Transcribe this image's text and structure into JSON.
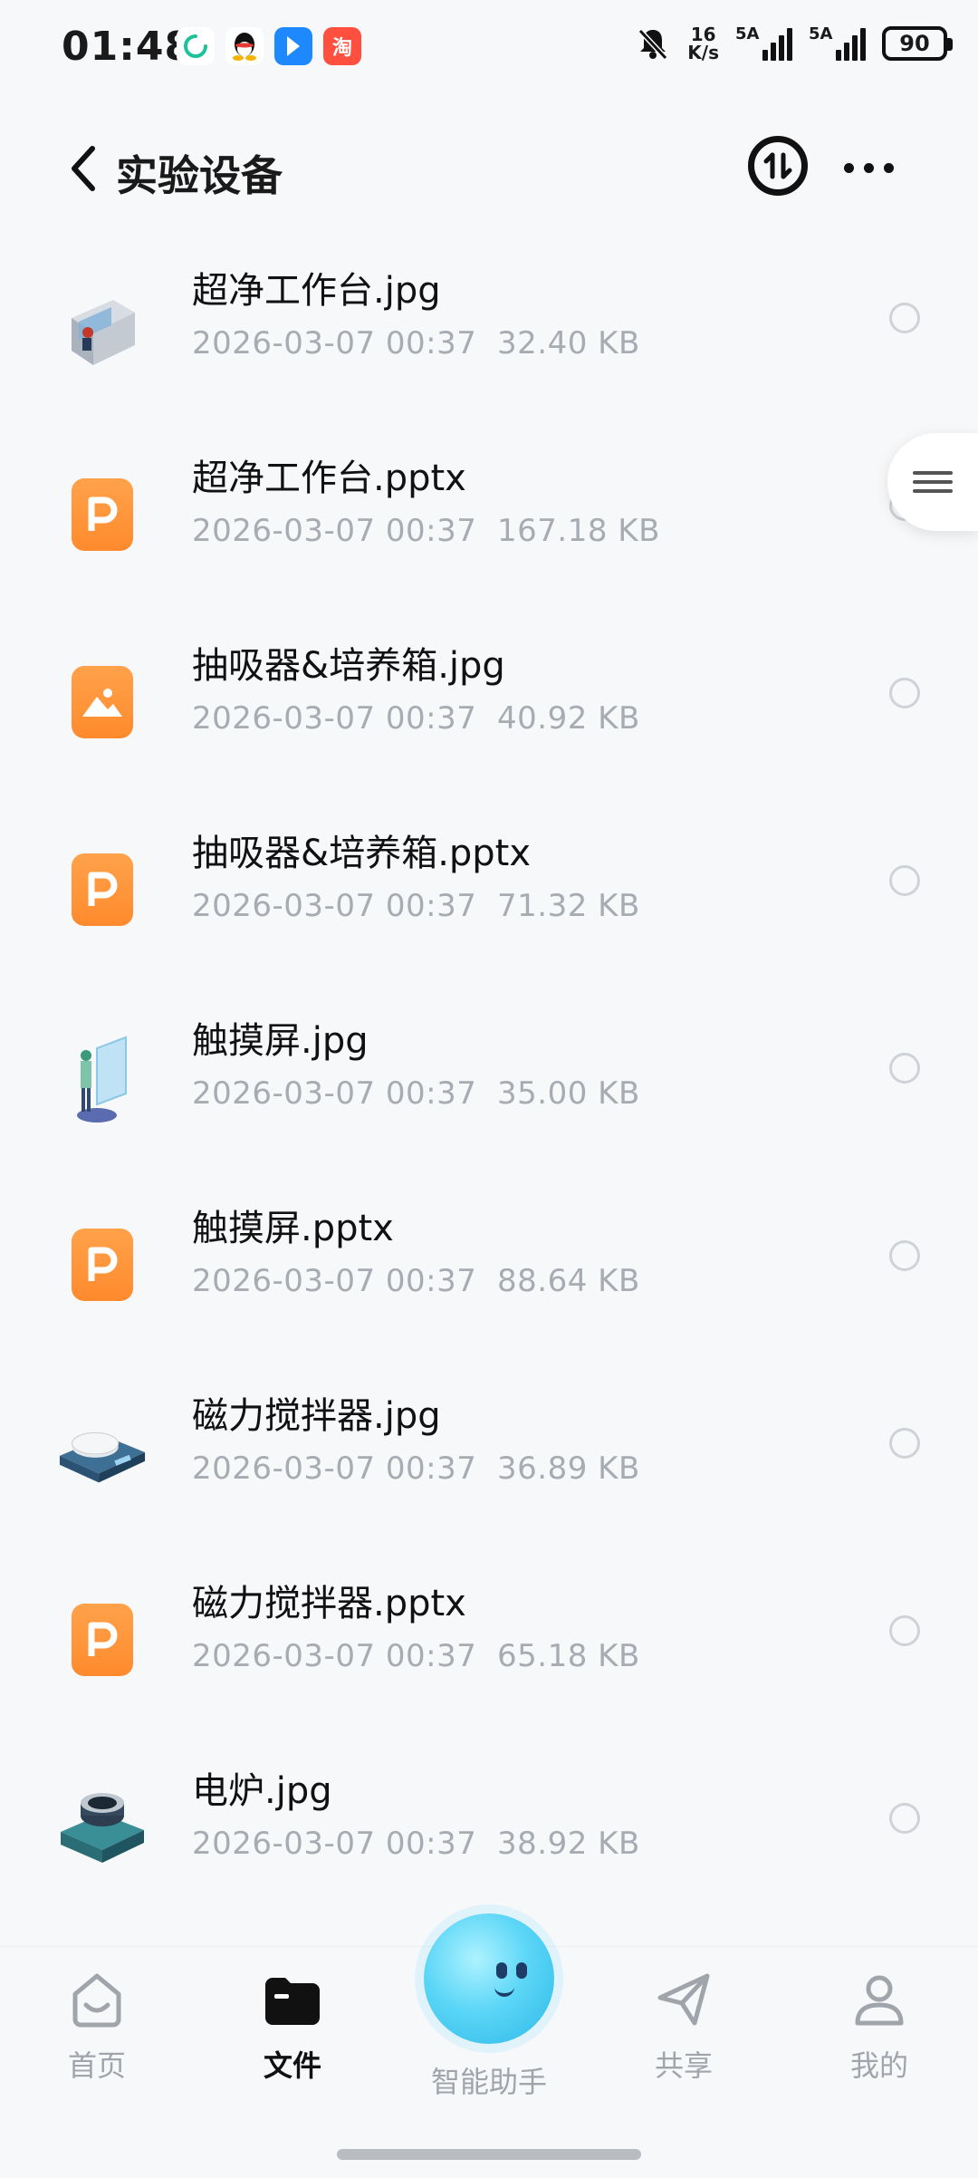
{
  "status_bar": {
    "time": "01:48",
    "net_speed_value": "16",
    "net_speed_unit": "K/s",
    "sim1_label": "5A",
    "sim2_label": "5A",
    "battery": "90",
    "app_icons": [
      "sync-icon",
      "qq-icon",
      "navigation-icon",
      "taobao-icon"
    ],
    "taobao_glyph": "淘"
  },
  "header": {
    "title": "实验设备"
  },
  "files": [
    {
      "name": "超净工作台.jpg",
      "date": "2026-03-07 00:37",
      "size": "32.40 KB",
      "type": "image-thumb",
      "thumb": "clean-bench"
    },
    {
      "name": "超净工作台.pptx",
      "date": "2026-03-07 00:37",
      "size": "167.18 KB",
      "type": "pptx"
    },
    {
      "name": "抽吸器&培养箱.jpg",
      "date": "2026-03-07 00:37",
      "size": "40.92 KB",
      "type": "image-generic"
    },
    {
      "name": "抽吸器&培养箱.pptx",
      "date": "2026-03-07 00:37",
      "size": "71.32 KB",
      "type": "pptx"
    },
    {
      "name": "触摸屏.jpg",
      "date": "2026-03-07 00:37",
      "size": "35.00 KB",
      "type": "image-thumb",
      "thumb": "touchscreen"
    },
    {
      "name": "触摸屏.pptx",
      "date": "2026-03-07 00:37",
      "size": "88.64 KB",
      "type": "pptx"
    },
    {
      "name": "磁力搅拌器.jpg",
      "date": "2026-03-07 00:37",
      "size": "36.89 KB",
      "type": "image-thumb",
      "thumb": "magnetic-stirrer"
    },
    {
      "name": "磁力搅拌器.pptx",
      "date": "2026-03-07 00:37",
      "size": "65.18 KB",
      "type": "pptx"
    },
    {
      "name": "电炉.jpg",
      "date": "2026-03-07 00:37",
      "size": "38.92 KB",
      "type": "image-thumb",
      "thumb": "electric-furnace"
    }
  ],
  "bottom_nav": {
    "items": [
      {
        "label": "首页",
        "icon": "home-icon"
      },
      {
        "label": "文件",
        "icon": "folder-icon",
        "active": true
      },
      {
        "label": "智能助手",
        "icon": "assistant-icon"
      },
      {
        "label": "共享",
        "icon": "share-icon"
      },
      {
        "label": "我的",
        "icon": "profile-icon"
      }
    ]
  },
  "colors": {
    "accent_orange": "#ff8a2d",
    "muted_text": "#a7abb2",
    "background": "#f7f8fa"
  }
}
